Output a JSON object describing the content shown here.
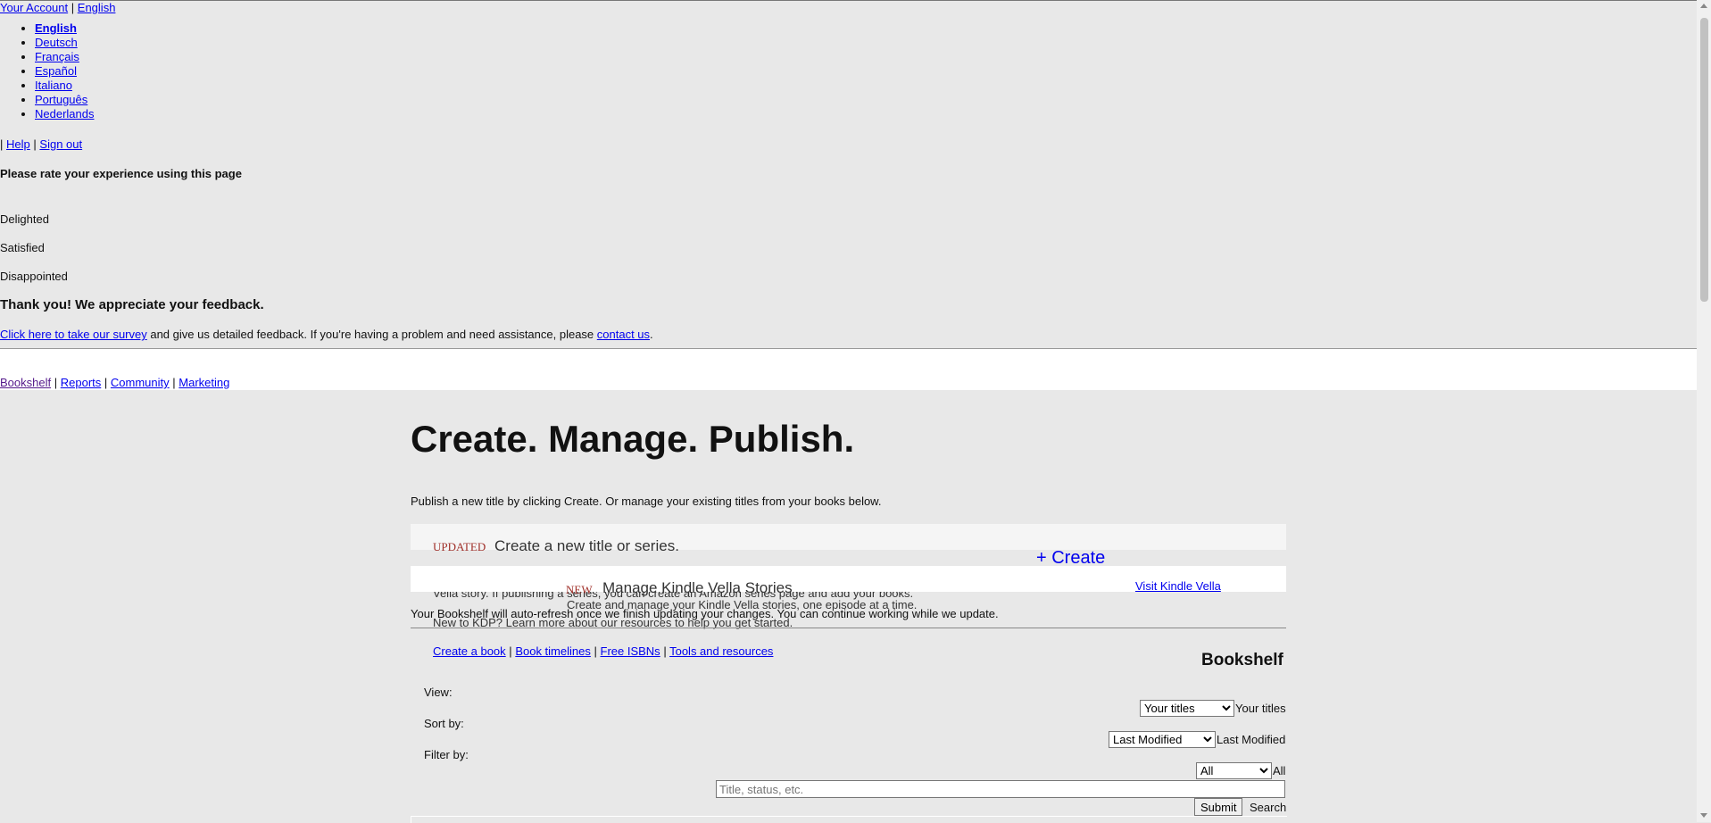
{
  "header": {
    "your_account": "Your Account",
    "separator": "|",
    "language_current": "English",
    "languages": [
      "English",
      "Deutsch",
      "Français",
      "Español",
      "Italiano",
      "Português",
      "Nederlands"
    ],
    "help_prefix": "|",
    "help": "Help",
    "sign_out": "Sign out"
  },
  "feedback": {
    "prompt": "Please rate your experience using this page",
    "options": [
      "Delighted",
      "Satisfied",
      "Disappointed"
    ],
    "thanks": "Thank you! We appreciate your feedback.",
    "survey_link": "Click here to take our survey",
    "survey_text": " and give us detailed feedback. If you're having a problem and need assistance, please ",
    "contact_link": "contact us",
    "period": "."
  },
  "nav": {
    "items": [
      "Bookshelf",
      "Reports",
      "Community",
      "Marketing"
    ],
    "sep": "|"
  },
  "main": {
    "title": "Create. Manage. Publish.",
    "intro": "Publish a new title by clicking Create. Or manage your existing titles from your books below.",
    "create_panel": {
      "badge": "UPDATED",
      "heading": "Create a new title or series.",
      "button": "+ Create",
      "hidden_text": "Vella story. If publishing a series, you can create an Amazon series page and add your books."
    },
    "vella_panel": {
      "badge": "NEW",
      "heading": "Manage Kindle Vella Stories",
      "sub": "Create and manage your Kindle Vella stories, one episode at a time.",
      "link": "Visit Kindle Vella"
    },
    "refresh_notice": "Your Bookshelf will auto-refresh once we finish updating your changes. You can continue working while we update.",
    "new_to_kdp": "New to KDP? Learn more about our resources to help you get started.",
    "resources": [
      "Create a book",
      "Book timelines",
      "Free ISBNs",
      "Tools and resources"
    ],
    "bookshelf_title": "Bookshelf",
    "view_label": "View:",
    "view_value": "Your titles",
    "sort_label": "Sort by:",
    "sort_value": "Last Modified",
    "filter_label": "Filter by:",
    "filter_value": "All",
    "search_placeholder": "Title, status, etc.",
    "submit": "Submit",
    "search": "Search"
  }
}
